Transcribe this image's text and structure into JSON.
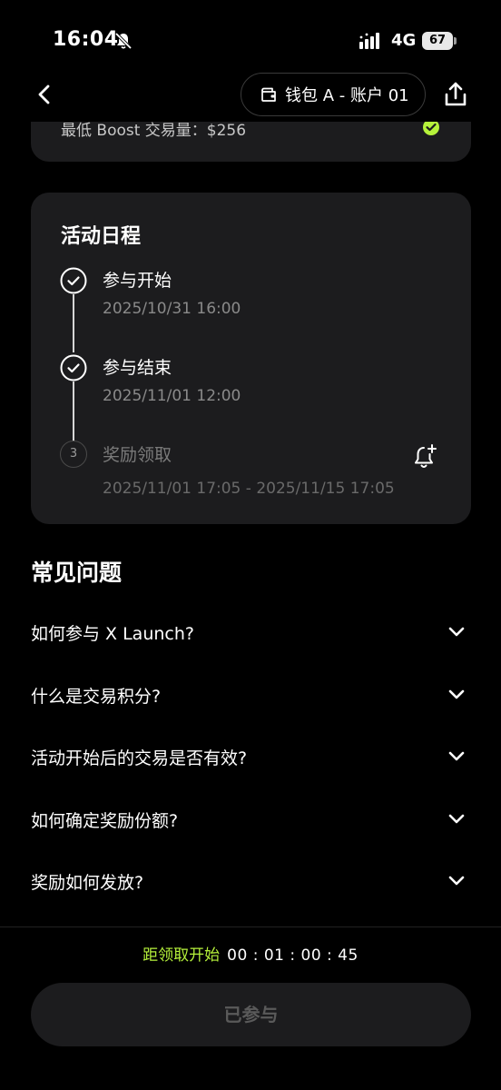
{
  "status_bar": {
    "time": "16:04",
    "network": "4G",
    "battery": "67"
  },
  "nav": {
    "wallet_label": "钱包 A - 账户 01"
  },
  "top_card": {
    "boost_text": "最低 Boost 交易量：$256"
  },
  "schedule": {
    "title": "活动日程",
    "steps": [
      {
        "label": "参与开始",
        "date": "2025/10/31 16:00",
        "status": "done"
      },
      {
        "label": "参与结束",
        "date": "2025/11/01 12:00",
        "status": "done"
      },
      {
        "number": "3",
        "label": "奖励领取",
        "date": "2025/11/01 17:05 - 2025/11/15 17:05",
        "status": "pending"
      }
    ]
  },
  "faq": {
    "title": "常见问题",
    "items": [
      {
        "question": "如何参与 X Launch?"
      },
      {
        "question": "什么是交易积分?"
      },
      {
        "question": "活动开始后的交易是否有效?"
      },
      {
        "question": "如何确定奖励份额?"
      },
      {
        "question": "奖励如何发放?"
      }
    ]
  },
  "countdown": {
    "label": "距领取开始",
    "time": "00 : 01 : 00 : 45"
  },
  "action_button": {
    "label": "已参与"
  },
  "colors": {
    "accent_green": "#b6f23b",
    "card_bg": "#1c1c1e",
    "background": "#000000"
  },
  "icons": [
    "bell-off-icon",
    "signal-icon",
    "battery-icon",
    "back-arrow-icon",
    "wallet-icon",
    "share-icon",
    "check-circle-icon",
    "bell-plus-icon",
    "chevron-down-icon"
  ]
}
